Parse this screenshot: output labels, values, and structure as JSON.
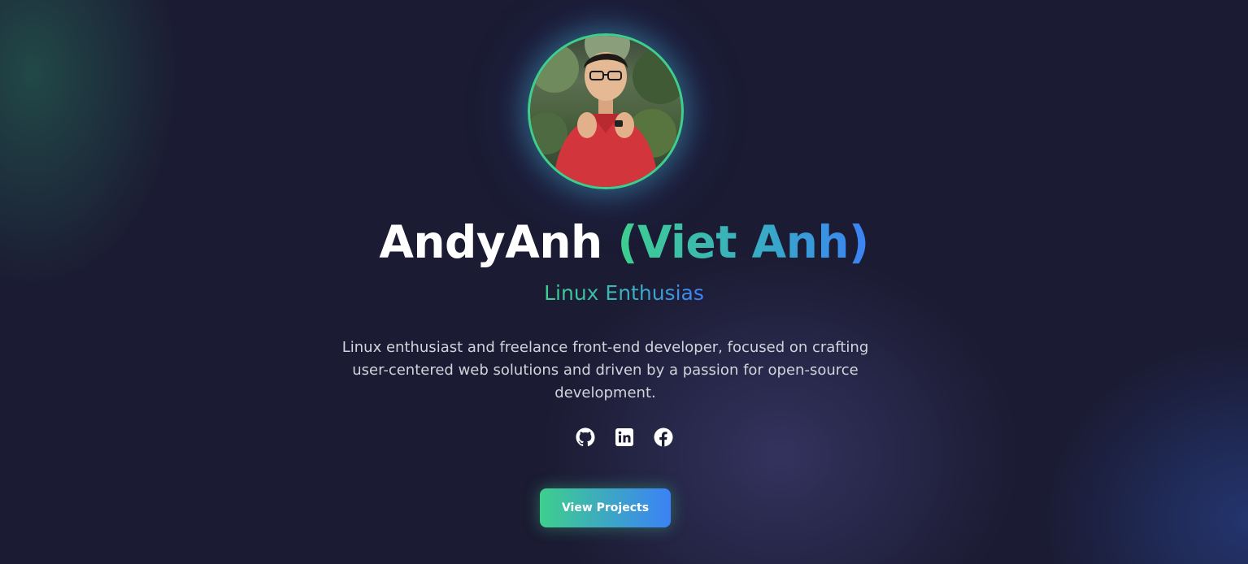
{
  "profile": {
    "name_primary": "AndyAnh",
    "name_secondary": "(Viet Anh)",
    "role": "Linux Enthusias",
    "bio": "Linux enthusiast and freelance front-end developer, focused on crafting user-centered web solutions and driven by a passion for open-source development."
  },
  "socials": [
    {
      "icon": "github-icon"
    },
    {
      "icon": "linkedin-icon"
    },
    {
      "icon": "facebook-icon"
    }
  ],
  "cta": {
    "label": "View Projects"
  },
  "colors": {
    "background": "#1b1b33",
    "accent_green": "#3ecf8e",
    "accent_blue": "#3b82f6",
    "text_muted": "#d1d5db"
  }
}
